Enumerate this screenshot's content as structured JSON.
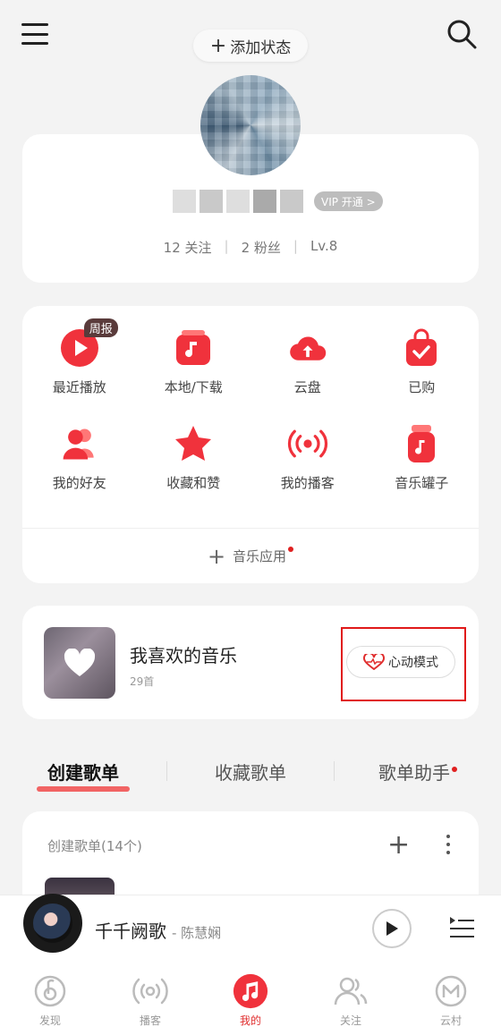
{
  "header": {
    "add_status_label": "添加状态"
  },
  "profile": {
    "vip_label": "VIP 开通 >",
    "stats": [
      "12 关注",
      "2 粉丝",
      "Lv.8"
    ]
  },
  "grid": {
    "items": [
      {
        "label": "最近播放",
        "icon": "play-circle-icon",
        "badge": "周报"
      },
      {
        "label": "本地/下载",
        "icon": "local-music-icon"
      },
      {
        "label": "云盘",
        "icon": "cloud-upload-icon"
      },
      {
        "label": "已购",
        "icon": "shopping-bag-icon"
      },
      {
        "label": "我的好友",
        "icon": "friends-icon"
      },
      {
        "label": "收藏和赞",
        "icon": "star-icon"
      },
      {
        "label": "我的播客",
        "icon": "podcast-icon"
      },
      {
        "label": "音乐罐子",
        "icon": "music-jar-icon"
      }
    ],
    "music_app_label": "音乐应用"
  },
  "favorites": {
    "title": "我喜欢的音乐",
    "count": "29首",
    "heartbeat_mode_label": "心动模式"
  },
  "tabs": [
    {
      "label": "创建歌单",
      "active": true
    },
    {
      "label": "收藏歌单",
      "active": false
    },
    {
      "label": "歌单助手",
      "active": false
    }
  ],
  "playlist_section": {
    "heading": "创建歌单(14个)"
  },
  "player": {
    "song": "千千阙歌",
    "artist": "- 陈慧娴"
  },
  "bottom_nav": [
    {
      "label": "发现",
      "icon": "discover-icon"
    },
    {
      "label": "播客",
      "icon": "podcast-icon"
    },
    {
      "label": "我的",
      "icon": "music-note-icon",
      "active": true
    },
    {
      "label": "关注",
      "icon": "follow-icon"
    },
    {
      "label": "云村",
      "icon": "cloud-village-icon"
    }
  ],
  "colors": {
    "accent": "#f0323c",
    "highlight": "#e01919"
  }
}
